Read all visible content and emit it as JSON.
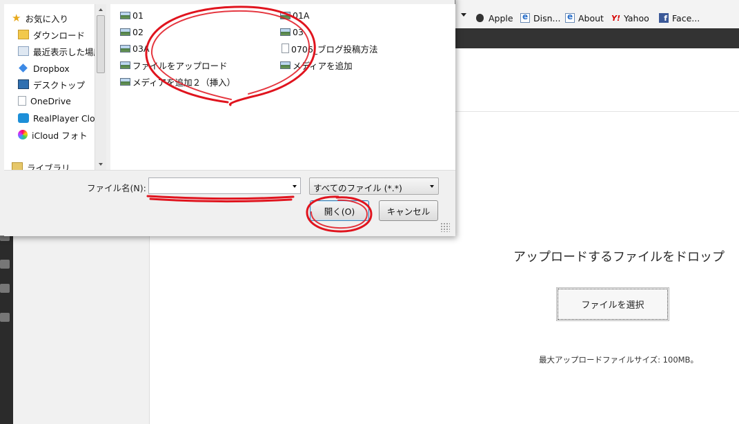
{
  "bookmarks": [
    {
      "label": "Apple",
      "icon": "apple-icon"
    },
    {
      "label": "Disn...",
      "icon": "ie-page-icon"
    },
    {
      "label": "About",
      "icon": "ie-page-icon"
    },
    {
      "label": "Yahoo",
      "icon": "yahoo-icon"
    },
    {
      "label": "Face...",
      "icon": "facebook-icon"
    }
  ],
  "yahoo_glyph": "Y!",
  "fb_glyph": "f",
  "upload": {
    "drop_text": "アップロードするファイルをドロップ",
    "select_button": "ファイルを選択",
    "max_size": "最大アップロードファイルサイズ: 100MB。"
  },
  "dialog": {
    "nav_items": [
      {
        "label": "お気に入り",
        "icon": "star-icon"
      },
      {
        "label": "ダウンロード",
        "icon": "download-folder-icon"
      },
      {
        "label": "最近表示した場所",
        "icon": "recent-places-icon"
      },
      {
        "label": "Dropbox",
        "icon": "dropbox-icon"
      },
      {
        "label": "デスクトップ",
        "icon": "desktop-icon"
      },
      {
        "label": "OneDrive",
        "icon": "onedrive-icon"
      },
      {
        "label": "RealPlayer Cloud",
        "icon": "realplayer-icon"
      },
      {
        "label": "iCloud フォト",
        "icon": "icloud-photos-icon"
      },
      {
        "label": "ライブラリ",
        "icon": "library-icon"
      }
    ],
    "files": [
      {
        "name": "01",
        "icon": "image-file-icon"
      },
      {
        "name": "01A",
        "icon": "image-file-icon"
      },
      {
        "name": "02",
        "icon": "image-file-icon"
      },
      {
        "name": "03",
        "icon": "image-file-icon"
      },
      {
        "name": "03A",
        "icon": "image-file-icon"
      },
      {
        "name": "0706_ブログ投稿方法",
        "icon": "text-file-icon"
      },
      {
        "name": "ファイルをアップロード",
        "icon": "image-file-icon"
      },
      {
        "name": "メディアを追加",
        "icon": "image-file-icon"
      },
      {
        "name": "メディアを追加２（挿入）",
        "icon": "image-file-icon"
      }
    ],
    "filename_label": "ファイル名(N):",
    "filename_value": "",
    "filter_value": "すべてのファイル (*.*)",
    "open_label": "開く(O)",
    "cancel_label": "キャンセル"
  },
  "colors": {
    "annotation_red": "#e0141e",
    "admin_bar": "#333333"
  }
}
